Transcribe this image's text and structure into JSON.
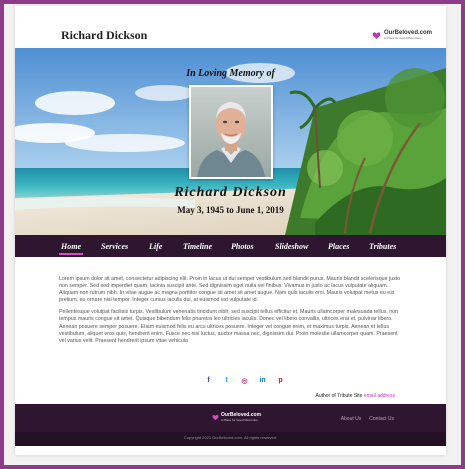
{
  "header": {
    "site_name": "Richard Dickson",
    "brand_name": "OurBeloved.com",
    "brand_tagline": "A Place for Good Memories"
  },
  "hero": {
    "memory_title": "In Loving Memory of",
    "name": "Richard Dickson",
    "dates": "May 3, 1945 to June 1, 2019"
  },
  "nav": {
    "items": [
      "Home",
      "Services",
      "Life",
      "Timeline",
      "Photos",
      "Slideshow",
      "Places",
      "Tributes"
    ],
    "active": "Home"
  },
  "content": {
    "paragraph_1": "Lorem ipsum dolor sit amet, consectetur adipiscing elit. Proin in lacus ut dui semper vestibulum sed blandit purus. Mauris blandit scelerisque justo non semper. Sed sed imperdiet quam, lacinia suscipit ante. Sed dignissim eget nulla vel finibus. Vivamus in justo ac lacus vulputate aliquam. Aliquam non rutrum nibh. In vitae augue ac magna porttitor congue sit amet sit amet augue. Nam quis iaculis orci. Mauris volutpat metus eu est pretium, eu ornare nisi tempor. Integer cursus iaculis dui, at euismod est vulputate id.",
    "paragraph_2": "Pellentesque volutpat facilisis turpis. Vestibulum venenatis tincidunt nibh, sed suscipit tellus efficitur et. Mauris ullamcorper malesuada tellus, non tempus mauris congue sit amet. Quisque bibendum felis pharetra leo ultricies iaculis. Donec vel libero convallis, ultrices erat et, pulvinar libero. Aenean posuere semper posuere. Etiam euismod felis eu arcu ultrices posuere. Integer vel congue enim, et maximus turpis. Aenean et tellus vestibulum, aliquet eros quis, hendrerit enim. Fusce nec nisi luctus, auctor massa nec, dignissim dui. Proin molestie ullamcorper quam. Praesent vel varius velit. Praesent hendrerit ipsum vitae vehicula"
  },
  "social": {
    "icons": [
      {
        "name": "facebook-icon",
        "glyph": "f",
        "color": "#3b5998"
      },
      {
        "name": "twitter-icon",
        "glyph": "t",
        "color": "#1da1f2"
      },
      {
        "name": "instagram-icon",
        "glyph": "◎",
        "color": "#c13584"
      },
      {
        "name": "linkedin-icon",
        "glyph": "in",
        "color": "#0077b5"
      },
      {
        "name": "pinterest-icon",
        "glyph": "p",
        "color": "#e60023"
      }
    ]
  },
  "author": {
    "label": "Author of Tribute Site",
    "link": "email address"
  },
  "footer": {
    "brand_name": "OurBeloved.com",
    "brand_tagline": "A Place for Good Memories",
    "links": [
      "About Us",
      "Contact Us"
    ],
    "copyright": "Copyright 2021 OurBeloved.com. All rights reserved."
  },
  "colors": {
    "frame": "#8e3c8a",
    "nav_bg": "#2e1530",
    "accent": "#d04fc7"
  }
}
